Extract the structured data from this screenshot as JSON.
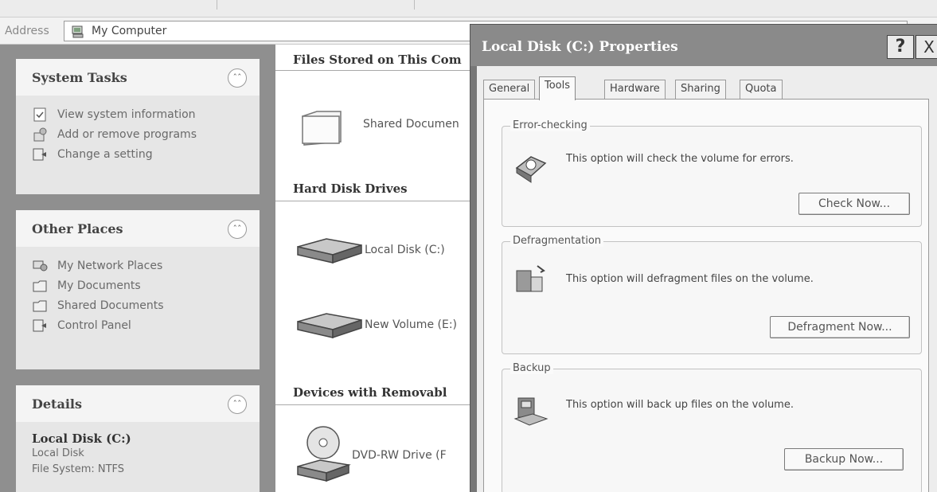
{
  "address_bar": {
    "label": "Address",
    "value": "My Computer",
    "icon": "my-computer-icon"
  },
  "sidebar": {
    "system_tasks": {
      "title": "System Tasks",
      "items": [
        {
          "label": "View system information",
          "icon": "system-info-icon"
        },
        {
          "label": "Add or remove programs",
          "icon": "add-remove-programs-icon"
        },
        {
          "label": "Change a setting",
          "icon": "control-panel-icon"
        }
      ]
    },
    "other_places": {
      "title": "Other Places",
      "items": [
        {
          "label": "My Network Places",
          "icon": "network-places-icon"
        },
        {
          "label": "My Documents",
          "icon": "documents-folder-icon"
        },
        {
          "label": "Shared Documents",
          "icon": "shared-folder-icon"
        },
        {
          "label": "Control Panel",
          "icon": "control-panel-icon"
        }
      ]
    },
    "details": {
      "title": "Details",
      "name": "Local Disk (C:)",
      "type": "Local Disk",
      "file_system": "File System: NTFS"
    }
  },
  "content": {
    "groups": [
      {
        "title": "Files Stored on This Com",
        "items": [
          {
            "label": "Shared Documen",
            "icon": "folder-icon"
          }
        ]
      },
      {
        "title": "Hard Disk Drives",
        "items": [
          {
            "label": "Local Disk (C:)",
            "icon": "hard-drive-icon"
          },
          {
            "label": "New Volume (E:)",
            "icon": "hard-drive-icon"
          }
        ]
      },
      {
        "title": "Devices with Removabl",
        "items": [
          {
            "label": "DVD-RW Drive (F",
            "icon": "dvd-drive-icon"
          }
        ]
      }
    ]
  },
  "dialog": {
    "title": "Local Disk (C:) Properties",
    "help_label": "?",
    "close_label": "X",
    "tabs": [
      "General",
      "Tools",
      "Hardware",
      "Sharing",
      "Quota"
    ],
    "active_tab": "Tools",
    "sections": [
      {
        "legend": "Error-checking",
        "description": "This option will check the volume for errors.",
        "button": "Check Now...",
        "icon": "error-check-icon"
      },
      {
        "legend": "Defragmentation",
        "description": "This option will defragment files on the volume.",
        "button": "Defragment Now...",
        "icon": "defragment-icon"
      },
      {
        "legend": "Backup",
        "description": "This option will back up files on the volume.",
        "button": "Backup Now...",
        "icon": "backup-icon"
      }
    ]
  }
}
